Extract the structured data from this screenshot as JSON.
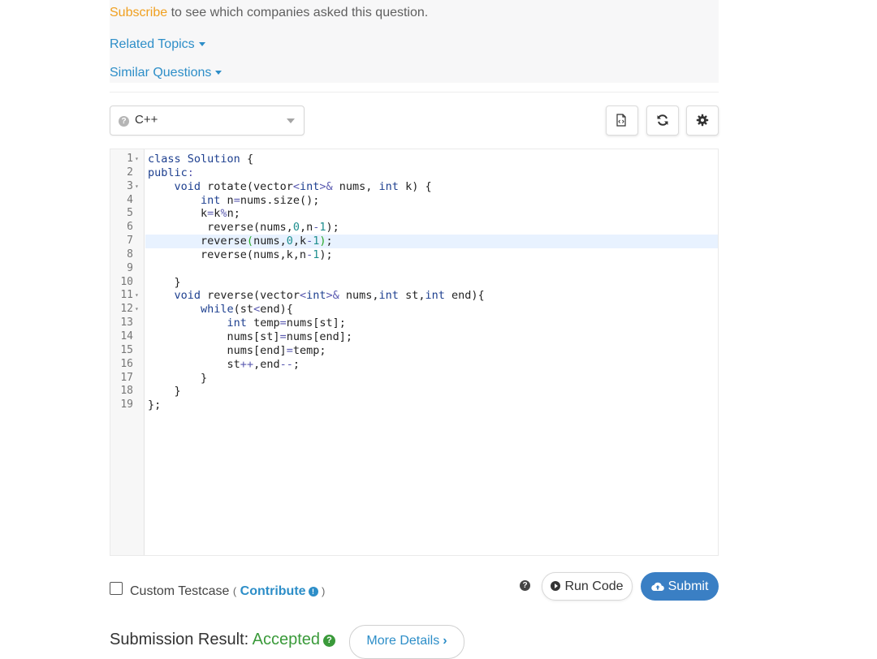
{
  "problem": {
    "subscribe_link": "Subscribe",
    "subscribe_text": " to see which companies asked this question.",
    "related_topics": "Related Topics",
    "similar_questions": "Similar Questions"
  },
  "toolbar": {
    "language": "C++",
    "icons": [
      "document-code-icon",
      "refresh-icon",
      "gear-icon"
    ]
  },
  "editor": {
    "active_line": 7,
    "lines": [
      {
        "n": "1",
        "fold": true,
        "code": "class Solution {"
      },
      {
        "n": "2",
        "fold": false,
        "code": "public:"
      },
      {
        "n": "3",
        "fold": true,
        "code": "    void rotate(vector<int>& nums, int k) {"
      },
      {
        "n": "4",
        "fold": false,
        "code": "        int n=nums.size();"
      },
      {
        "n": "5",
        "fold": false,
        "code": "        k=k%n;"
      },
      {
        "n": "6",
        "fold": false,
        "code": "         reverse(nums,0,n-1);"
      },
      {
        "n": "7",
        "fold": false,
        "code": "        reverse(nums,0,k-1);"
      },
      {
        "n": "8",
        "fold": false,
        "code": "        reverse(nums,k,n-1);"
      },
      {
        "n": "9",
        "fold": false,
        "code": ""
      },
      {
        "n": "10",
        "fold": false,
        "code": "    }"
      },
      {
        "n": "11",
        "fold": true,
        "code": "    void reverse(vector<int>& nums,int st,int end){"
      },
      {
        "n": "12",
        "fold": true,
        "code": "        while(st<end){"
      },
      {
        "n": "13",
        "fold": false,
        "code": "            int temp=nums[st];"
      },
      {
        "n": "14",
        "fold": false,
        "code": "            nums[st]=nums[end];"
      },
      {
        "n": "15",
        "fold": false,
        "code": "            nums[end]=temp;"
      },
      {
        "n": "16",
        "fold": false,
        "code": "            st++,end--;"
      },
      {
        "n": "17",
        "fold": false,
        "code": "        }"
      },
      {
        "n": "18",
        "fold": false,
        "code": "    }"
      },
      {
        "n": "19",
        "fold": false,
        "code": "};"
      }
    ]
  },
  "actions": {
    "custom_testcase": "Custom Testcase",
    "paren_open": "(",
    "contribute": "Contribute",
    "paren_close": ")",
    "run_code": "Run Code",
    "submit": "Submit"
  },
  "result": {
    "label": "Submission Result: ",
    "status": "Accepted",
    "more_details": "More Details"
  },
  "colors": {
    "accent": "#2d8ec8",
    "subscribe": "#f0a020",
    "accepted": "#3a9a3a",
    "submit_bg": "#3a7fc4"
  }
}
